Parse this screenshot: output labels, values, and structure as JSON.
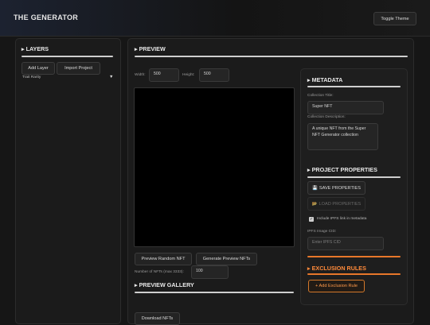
{
  "header": {
    "title": "THE GENERATOR",
    "toggle_theme": "Toggle Theme"
  },
  "layers": {
    "title": "▸ LAYERS",
    "add_layer": "Add Layer",
    "import_project": "Import Project",
    "trait_rarity": "Trait Rarity",
    "collapse_glyph": "▼"
  },
  "preview": {
    "title": "▸ PREVIEW",
    "width_label": "Width:",
    "width_value": "500",
    "height_label": "Height:",
    "height_value": "500",
    "preview_random": "Preview Random NFT",
    "generate_preview": "Generate Preview NFTs",
    "num_nfts_label": "Number of NFTs (max 3333):",
    "num_nfts_value": "100",
    "gallery_title": "▸ PREVIEW GALLERY",
    "download": "Download NFTs"
  },
  "metadata": {
    "title": "▸ METADATA",
    "collection_title_label": "Collection Title:",
    "collection_title_value": "Super NFT",
    "collection_desc_label": "Collection Description:",
    "collection_desc_value": "A unique NFT from the Super NFT Generator collection"
  },
  "project": {
    "title": "▸ PROJECT PROPERTIES",
    "save": "SAVE PROPERTIES",
    "save_icon": "💾",
    "load": "LOAD PROPERTIES",
    "load_icon": "📂",
    "ipfs_check_label": "Include IPFS link in metadata",
    "ipfs_checked": true,
    "ipfs_cid_label": "IPFS Image CID:",
    "ipfs_cid_placeholder": "Enter IPFS CID"
  },
  "exclusion": {
    "title": "▸ EXCLUSION RULES",
    "add_rule": "+ Add Exclusion Rule",
    "accent_color": "#e8772a"
  }
}
